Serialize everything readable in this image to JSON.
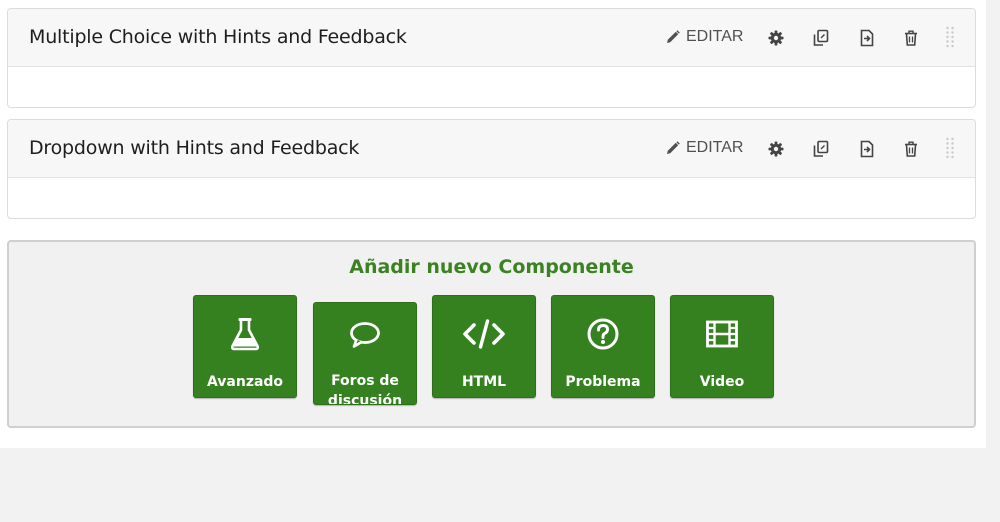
{
  "unit_blocks": [
    {
      "title": "Multiple Choice with Hints and Feedback",
      "edit_label": "EDITAR"
    },
    {
      "title": "Dropdown with Hints and Feedback",
      "edit_label": "EDITAR"
    }
  ],
  "block_action_icons": [
    "pencil-icon",
    "gear-icon",
    "duplicate-icon",
    "move-icon",
    "trash-icon",
    "drag-handle-icon"
  ],
  "add_component": {
    "title": "Añadir nuevo Componente",
    "buttons": [
      {
        "label": "Avanzado",
        "icon": "flask-icon"
      },
      {
        "label": "Foros de discusión",
        "icon": "speech-bubble-icon"
      },
      {
        "label": "HTML",
        "icon": "code-icon"
      },
      {
        "label": "Problema",
        "icon": "question-circle-icon"
      },
      {
        "label": "Video",
        "icon": "film-icon"
      }
    ]
  },
  "colors": {
    "accent_green": "#35811f",
    "title_green": "#3b8223",
    "panel_bg": "#f1f1f1",
    "header_bg": "#f7f7f7"
  }
}
